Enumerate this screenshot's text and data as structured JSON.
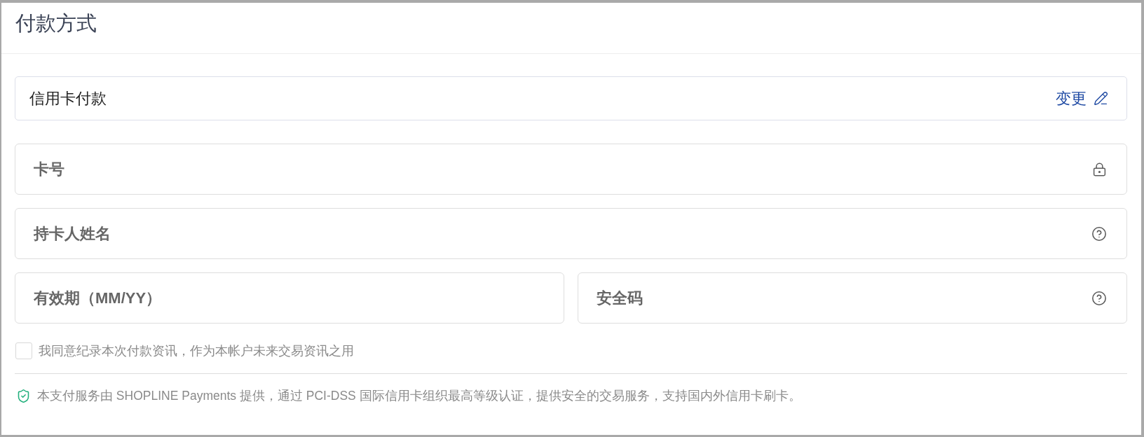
{
  "panel": {
    "title": "付款方式"
  },
  "payment_method": {
    "label": "信用卡付款",
    "change_link": "变更"
  },
  "field_rows": [
    {
      "fields": [
        {
          "kind": "locked",
          "placeholder": "卡号"
        }
      ]
    },
    {
      "fields": [
        {
          "kind": "help",
          "placeholder": "持卡人姓名"
        }
      ]
    },
    {
      "fields": [
        {
          "kind": "plain",
          "placeholder": "有效期（MM/YY）"
        },
        {
          "kind": "help",
          "placeholder": "安全码"
        }
      ]
    }
  ],
  "consent": {
    "label": "我同意纪录本次付款资讯，作为本帐户未来交易资讯之用",
    "checked": false
  },
  "security_notice": {
    "text": "本支付服务由 SHOPLINE Payments 提供，通过 PCI-DSS 国际信用卡组织最高等级认证，提供安全的交易服务，支持国内外信用卡刷卡。"
  }
}
